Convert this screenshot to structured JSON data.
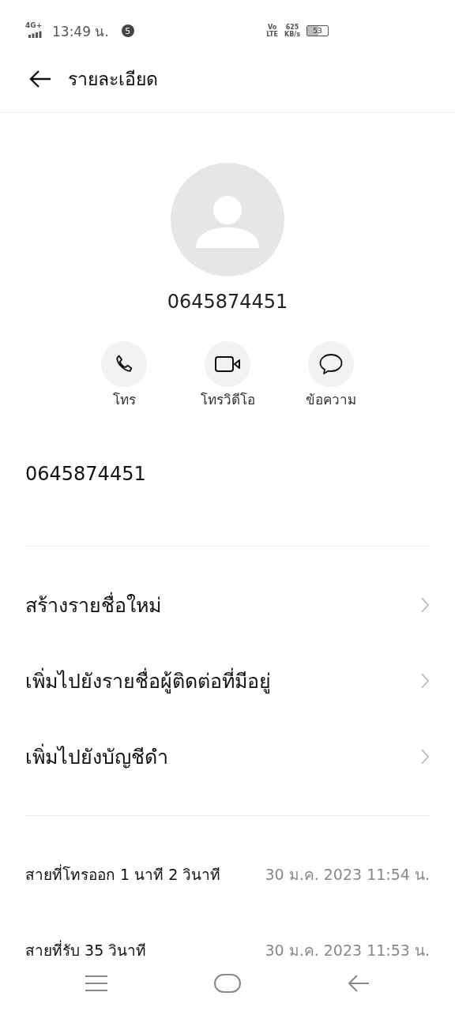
{
  "status_bar": {
    "network": "4G+",
    "time": "13:49 น.",
    "notification_count": "5",
    "volte": "Vo",
    "lte": "LTE",
    "speed": "625",
    "speed_unit": "KB/s",
    "battery": "53"
  },
  "header": {
    "title": "รายละเอียด"
  },
  "contact": {
    "number": "0645874451"
  },
  "actions": [
    {
      "kind": "call",
      "label": "โทร"
    },
    {
      "kind": "video",
      "label": "โทรวิดีโอ"
    },
    {
      "kind": "message",
      "label": "ข้อความ"
    }
  ],
  "phone_number": "0645874451",
  "menu": [
    {
      "label": "สร้างรายชื่อใหม่"
    },
    {
      "label": "เพิ่มไปยังรายชื่อผู้ติดต่อที่มีอยู่"
    },
    {
      "label": "เพิ่มไปยังบัญชีดำ"
    }
  ],
  "call_log": [
    {
      "description": "สายที่โทรออก 1 นาที 2 วินาที",
      "time": "30 ม.ค. 2023 11:54 น."
    },
    {
      "description": "สายที่รับ 35 วินาที",
      "time": "30 ม.ค. 2023 11:53 น."
    }
  ]
}
